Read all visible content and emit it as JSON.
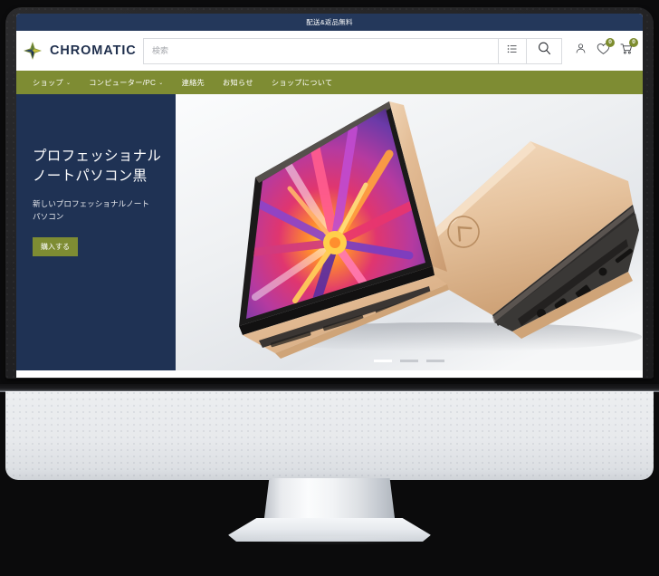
{
  "promo": {
    "text": "配送&返品無料",
    "bg": "#24385b"
  },
  "header": {
    "brand_name": "CHROMATIC",
    "logo_icon": "four-point-star-diamond-logo",
    "search": {
      "placeholder": "検索",
      "value": "",
      "filter_icon": "list-lines-icon",
      "submit_icon": "search-magnifier-icon"
    },
    "actions": [
      {
        "name": "account",
        "icon": "user-person-icon",
        "badge": null
      },
      {
        "name": "wishlist",
        "icon": "heart-icon",
        "badge": "0"
      },
      {
        "name": "cart",
        "icon": "shopping-cart-icon",
        "badge": "0"
      }
    ]
  },
  "nav": {
    "bg": "#7e8c33",
    "items": [
      {
        "label": "ショップ",
        "has_dropdown": true,
        "caret": "⌄"
      },
      {
        "label": "コンピューター/PC",
        "has_dropdown": true,
        "caret": "⌄"
      },
      {
        "label": "連絡先",
        "has_dropdown": false,
        "caret": ""
      },
      {
        "label": "お知らせ",
        "has_dropdown": false,
        "caret": ""
      },
      {
        "label": "ショップについて",
        "has_dropdown": false,
        "caret": ""
      }
    ]
  },
  "hero": {
    "panel_bg": "#1f3254",
    "title": "プロフェッショナルノートパソコン黒",
    "subtitle": "新しいプロフェッショナルノートパソコン",
    "cta_label": "購入する",
    "cta_bg": "#7e8c33",
    "image_alt": "ローズゴールドのノートパソコン2台、1台は開いてカラフルな花の壁紙を表示",
    "carousel": {
      "slides": 3,
      "active_index": 0
    }
  },
  "device": {
    "type": "desktop-monitor-mockup",
    "bezel_color": "#232325",
    "chin_color": "#e7e9ec",
    "background": "#0b0b0c"
  }
}
